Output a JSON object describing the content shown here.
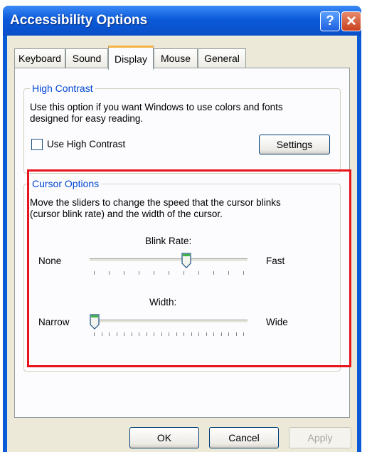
{
  "window": {
    "title": "Accessibility Options",
    "help_glyph": "?",
    "close_glyph": "✕"
  },
  "tabs": [
    {
      "label": "Keyboard"
    },
    {
      "label": "Sound"
    },
    {
      "label": "Display",
      "active": true
    },
    {
      "label": "Mouse"
    },
    {
      "label": "General"
    }
  ],
  "high_contrast": {
    "group_label": "High Contrast",
    "description_line1": "Use this option if you want Windows to use colors and fonts",
    "description_line2": "designed for easy reading.",
    "checkbox_label": "Use High Contrast",
    "checked": false,
    "settings_button": "Settings"
  },
  "cursor_options": {
    "group_label": "Cursor Options",
    "description_line1": "Move the sliders to change the speed that the cursor blinks",
    "description_line2": "(cursor blink rate) and the width of the cursor.",
    "blink_rate": {
      "label": "Blink Rate:",
      "min_label": "None",
      "max_label": "Fast",
      "value_fraction": 0.62
    },
    "width": {
      "label": "Width:",
      "min_label": "Narrow",
      "max_label": "Wide",
      "value_fraction": 0.0
    }
  },
  "buttons": {
    "ok": "OK",
    "cancel": "Cancel",
    "apply": "Apply"
  },
  "colors": {
    "highlight_box": "#e8141c",
    "group_label": "#0046d5",
    "title_bar": "#0b5ad9"
  }
}
